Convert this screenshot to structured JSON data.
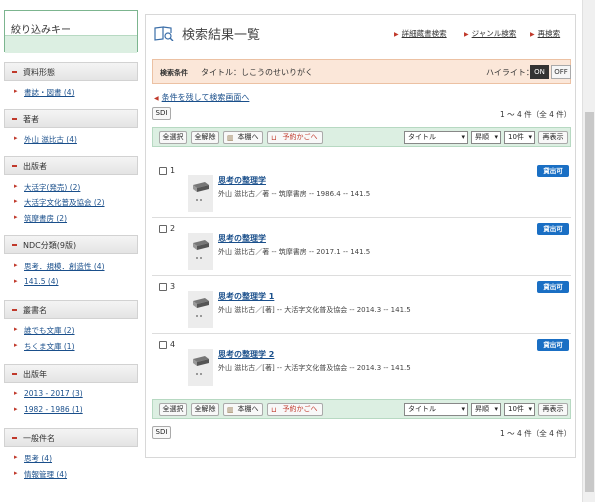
{
  "sidebar": {
    "title": "絞り込みキー",
    "sections": [
      {
        "title": "資料形態",
        "items": [
          "書誌・図書 (4)"
        ]
      },
      {
        "title": "著者",
        "items": [
          "外山 滋比古 (4)"
        ]
      },
      {
        "title": "出版者",
        "items": [
          "大活字(発売) (2)",
          "大活字文化普及協会 (2)",
          "筑摩書房 (2)"
        ]
      },
      {
        "title": "NDC分類(9版)",
        "items": [
          "思考．規模．創造性 (4)",
          "141.5 (4)"
        ]
      },
      {
        "title": "叢書名",
        "items": [
          "誰でも文庫 (2)",
          "ちくま文庫 (1)"
        ]
      },
      {
        "title": "出版年",
        "items": [
          "2013 - 2017 (3)",
          "1982 - 1986 (1)"
        ]
      },
      {
        "title": "一般件名",
        "items": [
          "思考 (4)",
          "情報管理 (4)"
        ]
      }
    ]
  },
  "main": {
    "title": "検索結果一覧",
    "top_links": [
      "詳細蔵書検索",
      "ジャンル検索",
      "再検索"
    ],
    "condition_label": "検索条件",
    "condition_value": "タイトル：しこうのせいりがく",
    "highlight_label": "ハイライト：",
    "toggle_on": "ON",
    "toggle_off": "OFF",
    "keep_conditions_link": "条件を残して検索画面へ",
    "sdi_label": "SDI",
    "count_text": "1 ～ 4 件（全 4 件）",
    "toolbar": {
      "select_all": "全選択",
      "clear_all": "全解除",
      "bookshelf": "本棚へ",
      "reserve_basket": "予約かごへ",
      "sort_field": "タイトル",
      "sort_order": "昇順",
      "per_page": "10件",
      "redisplay": "再表示"
    },
    "records": [
      {
        "num": "1",
        "title": "思考の整理学",
        "details": "外山 滋比古／著 -- 筑摩書房 -- 1986.4 -- 141.5",
        "badge": "貸出可"
      },
      {
        "num": "2",
        "title": "思考の整理学",
        "details": "外山 滋比古／著 -- 筑摩書房 -- 2017.1 -- 141.5",
        "badge": "貸出可"
      },
      {
        "num": "3",
        "title": "思考の整理学 1",
        "details": "外山 滋比古／[著] -- 大活字文化普及協会 -- 2014.3 -- 141.5",
        "badge": "貸出可"
      },
      {
        "num": "4",
        "title": "思考の整理学 2",
        "details": "外山 滋比古／[著] -- 大活字文化普及協会 -- 2014.3 -- 141.5",
        "badge": "貸出可"
      }
    ]
  },
  "colors": {
    "accent_red": "#c0392b",
    "badge_blue": "#1a6fc4",
    "toolbar_green": "#dcefe2",
    "condition_bg": "#fbe7d9"
  }
}
